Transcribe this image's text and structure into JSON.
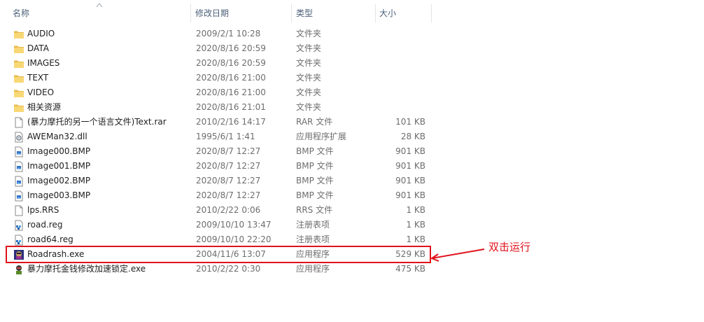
{
  "columns": {
    "name": "名称",
    "date": "修改日期",
    "type": "类型",
    "size": "大小"
  },
  "files": [
    {
      "icon": "folder-icon",
      "name": "AUDIO",
      "date": "2009/2/1 10:28",
      "type": "文件夹",
      "size": ""
    },
    {
      "icon": "folder-icon",
      "name": "DATA",
      "date": "2020/8/16 20:59",
      "type": "文件夹",
      "size": ""
    },
    {
      "icon": "folder-icon",
      "name": "IMAGES",
      "date": "2020/8/16 20:59",
      "type": "文件夹",
      "size": ""
    },
    {
      "icon": "folder-icon",
      "name": "TEXT",
      "date": "2020/8/16 21:00",
      "type": "文件夹",
      "size": ""
    },
    {
      "icon": "folder-icon",
      "name": "VIDEO",
      "date": "2020/8/16 21:00",
      "type": "文件夹",
      "size": ""
    },
    {
      "icon": "folder-icon",
      "name": "相关资源",
      "date": "2020/8/16 21:01",
      "type": "文件夹",
      "size": ""
    },
    {
      "icon": "file-icon",
      "name": "(暴力摩托的另一个语言文件)Text.rar",
      "date": "2010/2/16 14:17",
      "type": "RAR 文件",
      "size": "101 KB"
    },
    {
      "icon": "dll-file-icon",
      "name": "AWEMan32.dll",
      "date": "1995/6/1 1:41",
      "type": "应用程序扩展",
      "size": "28 KB"
    },
    {
      "icon": "image-file-icon",
      "name": "Image000.BMP",
      "date": "2020/8/7 12:27",
      "type": "BMP 文件",
      "size": "901 KB"
    },
    {
      "icon": "image-file-icon",
      "name": "Image001.BMP",
      "date": "2020/8/7 12:27",
      "type": "BMP 文件",
      "size": "901 KB"
    },
    {
      "icon": "image-file-icon",
      "name": "Image002.BMP",
      "date": "2020/8/7 12:27",
      "type": "BMP 文件",
      "size": "901 KB"
    },
    {
      "icon": "image-file-icon",
      "name": "Image003.BMP",
      "date": "2020/8/7 12:27",
      "type": "BMP 文件",
      "size": "901 KB"
    },
    {
      "icon": "file-icon",
      "name": "lps.RRS",
      "date": "2010/2/22 0:06",
      "type": "RRS 文件",
      "size": "1 KB"
    },
    {
      "icon": "registry-file-icon",
      "name": "road.reg",
      "date": "2009/10/10 13:47",
      "type": "注册表项",
      "size": "1 KB"
    },
    {
      "icon": "registry-file-icon",
      "name": "road64.reg",
      "date": "2009/10/10 22:20",
      "type": "注册表项",
      "size": "1 KB"
    },
    {
      "icon": "roadrash-app-icon",
      "name": "Roadrash.exe",
      "date": "2004/11/6 13:07",
      "type": "应用程序",
      "size": "529 KB"
    },
    {
      "icon": "trainer-app-icon",
      "name": "暴力摩托金钱修改加速锁定.exe",
      "date": "2010/2/22 0:30",
      "type": "应用程序",
      "size": "475 KB"
    }
  ],
  "annotation": {
    "text": "双击运行",
    "color": "#e0121b"
  },
  "colors": {
    "folder": "#f8d775",
    "header_text": "#4c607a",
    "annotation": "#e0121b"
  }
}
